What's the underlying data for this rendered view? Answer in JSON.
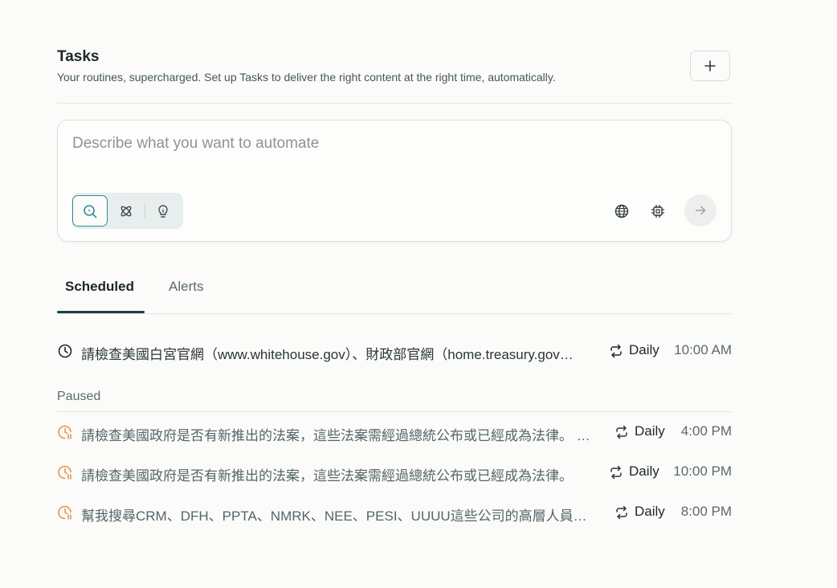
{
  "header": {
    "title": "Tasks",
    "subtitle": "Your routines, supercharged. Set up Tasks to deliver the right content at the right time, automatically.",
    "add_icon": "plus-icon"
  },
  "composer": {
    "placeholder": "Describe what you want to automate",
    "modes": [
      "search-icon",
      "sparkle-icon",
      "lightbulb-icon"
    ],
    "tools": [
      "globe-icon",
      "chip-icon"
    ],
    "submit_icon": "arrow-right-icon"
  },
  "tabs": {
    "scheduled": "Scheduled",
    "alerts": "Alerts"
  },
  "scheduled": [
    {
      "text": "請檢查美國白宮官網（www.whitehouse.gov）、財政部官網（home.treasury.gov…",
      "frequency": "Daily",
      "time": "10:00 AM"
    }
  ],
  "paused_label": "Paused",
  "paused": [
    {
      "text": "請檢查美國政府是否有新推出的法案，這些法案需經過總統公布或已經成為法律。 …",
      "frequency": "Daily",
      "time": "4:00 PM"
    },
    {
      "text": "請檢查美國政府是否有新推出的法案，這些法案需經過總統公布或已經成為法律。",
      "frequency": "Daily",
      "time": "10:00 PM"
    },
    {
      "text": "幫我搜尋CRM、DFH、PPTA、NMRK、NEE、PESI、UUUU這些公司的高層人員…",
      "frequency": "Daily",
      "time": "8:00 PM"
    }
  ],
  "colors": {
    "accent": "#2f8f9d",
    "paused_icon": "#e6954c",
    "tab_underline": "#1c3e46"
  }
}
